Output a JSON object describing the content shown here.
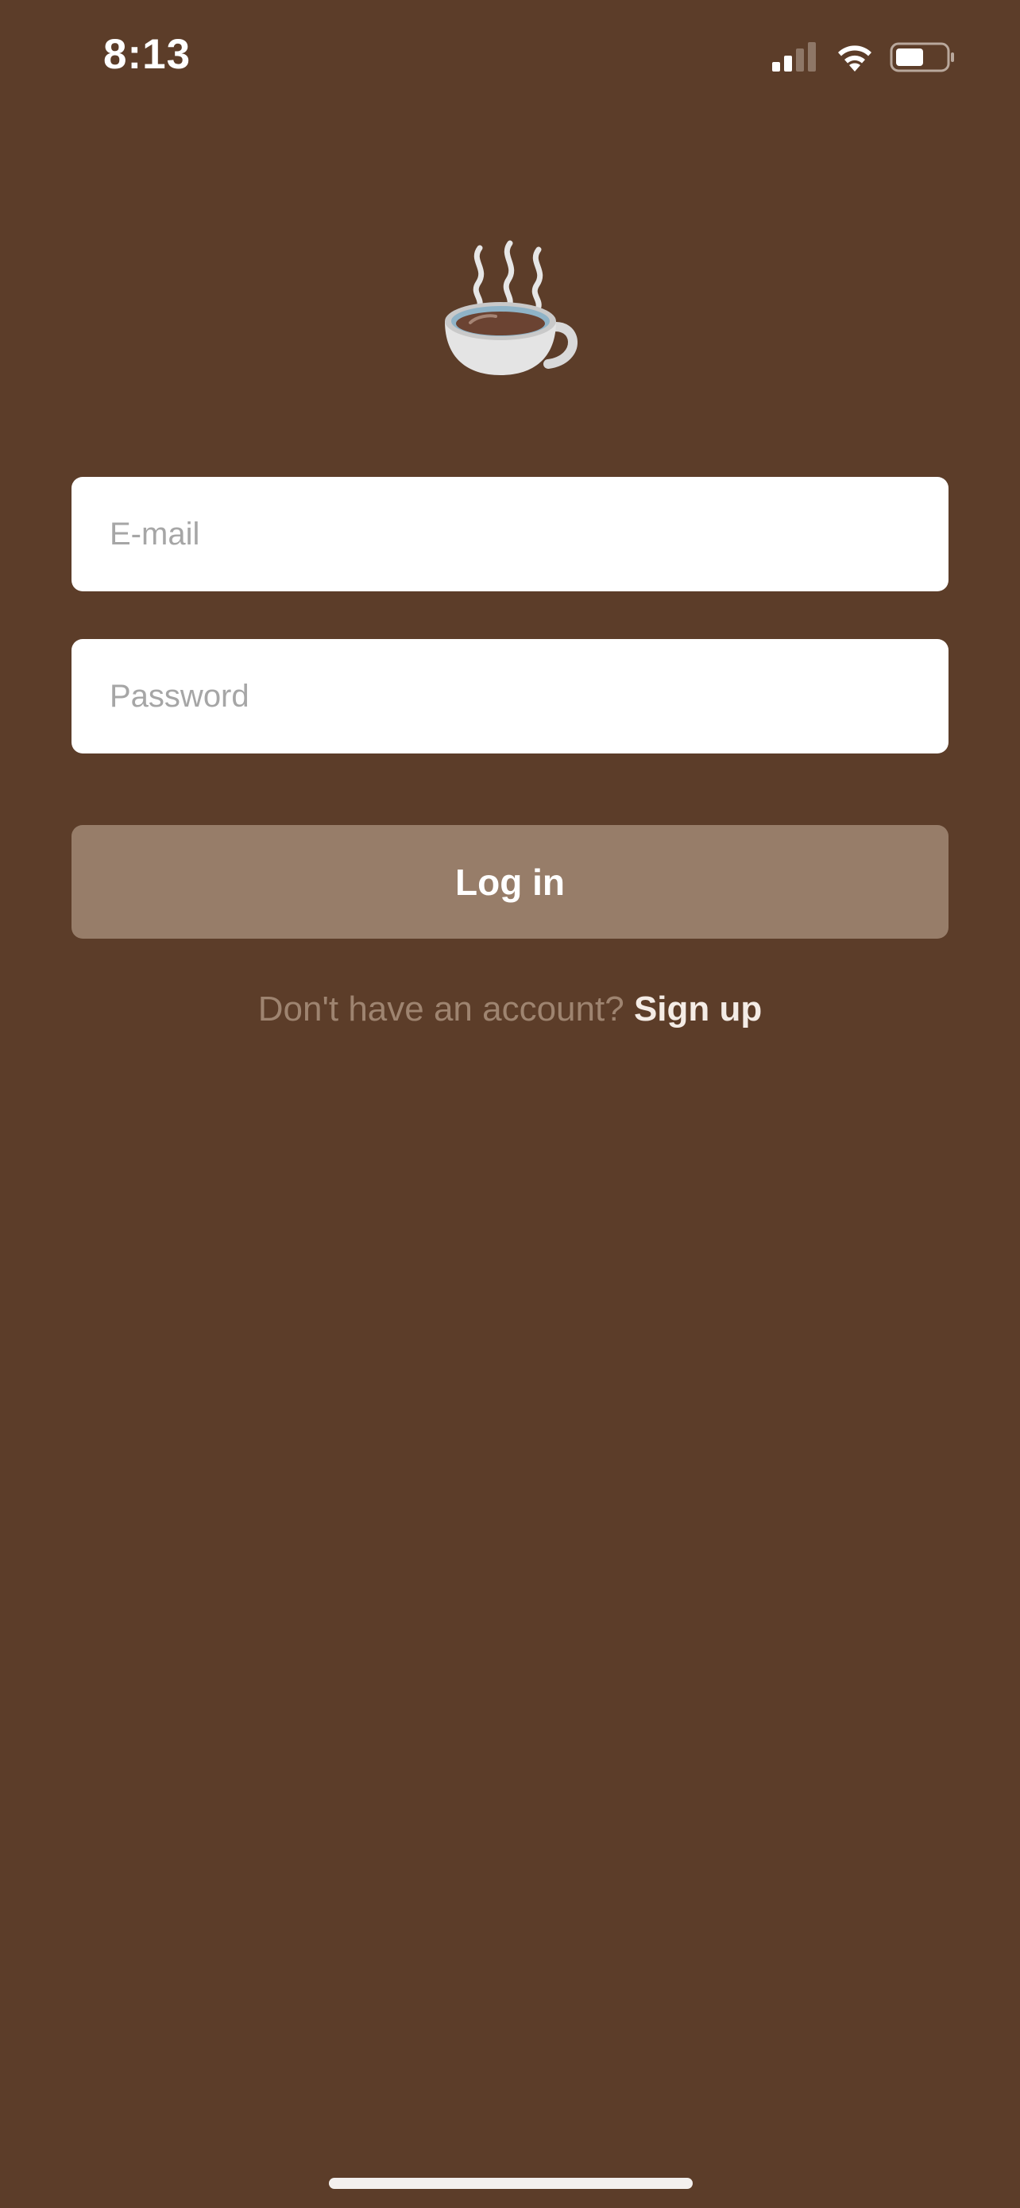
{
  "status_bar": {
    "time": "8:13",
    "signal_icon": "cellular-signal-icon",
    "wifi_icon": "wifi-icon",
    "battery_icon": "battery-icon",
    "battery_level": 0.5
  },
  "logo": {
    "icon": "hot-coffee-cup-icon"
  },
  "form": {
    "email_placeholder": "E-mail",
    "email_value": "",
    "password_placeholder": "Password",
    "password_value": "",
    "login_label": "Log in"
  },
  "signup": {
    "prompt": "Don't have an account?",
    "link_label": "Sign up"
  },
  "colors": {
    "background": "#5c3d29",
    "button": "#977d69",
    "prompt_text": "#9e8470",
    "link_text": "#f4ece6"
  }
}
